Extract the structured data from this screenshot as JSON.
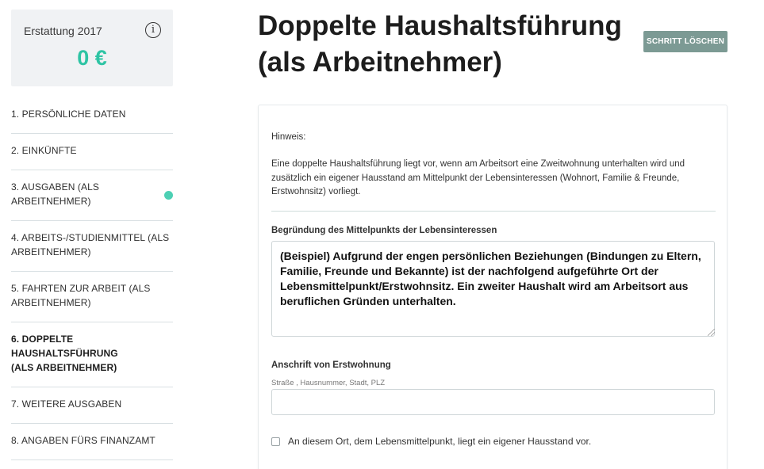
{
  "sidebar": {
    "refund_label": "Erstattung 2017",
    "refund_amount": "0 €",
    "info_icon_glyph": "i",
    "nav_items": [
      {
        "label": "1. Persönliche Daten"
      },
      {
        "label": "2. Einkünfte"
      },
      {
        "label": "3. Ausgaben (als Arbeitnehmer)"
      },
      {
        "label": "4. Arbeits-/Studienmittel (als Arbeitnehmer)"
      },
      {
        "label": "5. Fahrten zur Arbeit (als Arbeitnehmer)"
      },
      {
        "label": "6. Doppelte Haushaltsführung (als Arbeitnehmer)"
      },
      {
        "label": "7. Weitere Ausgaben"
      },
      {
        "label": "8. Angaben fürs Finanzamt"
      }
    ]
  },
  "header": {
    "title": "Doppelte Haushaltsführung (als Arbeitnehmer)",
    "delete_button": "Schritt löschen"
  },
  "form": {
    "hint_title": "Hinweis:",
    "hint_text": "Eine doppelte Haushaltsführung liegt vor, wenn am Arbeitsort eine Zweitwohnung unterhalten wird und zusätzlich ein eigener Hausstand am Mittelpunkt der Lebensinteressen (Wohnort, Familie & Freunde, Erstwohnsitz) vorliegt.",
    "reason_label": "Begründung des Mittelpunkts der Lebensinteressen",
    "reason_value": "(Beispiel) Aufgrund der engen persönlichen Beziehungen (Bindungen zu Eltern, Familie, Freunde und Bekannte) ist der nachfolgend aufgeführte Ort der Lebensmittelpunkt/Erstwohnsitz. Ein zweiter Haushalt wird am Arbeitsort aus beruflichen Gründen unterhalten.",
    "address_label": "Anschrift von Erstwohnung",
    "address_sublabel": "Straße , Hausnummer, Stadt, PLZ",
    "address_value": "",
    "checkbox_label": "An diesem Ort, dem Lebensmittelpunkt, liegt ein eigener Hausstand vor."
  },
  "colors": {
    "accent": "#2ec4a4",
    "button": "#7c9a94",
    "status_dot": "#4dd0b4"
  }
}
